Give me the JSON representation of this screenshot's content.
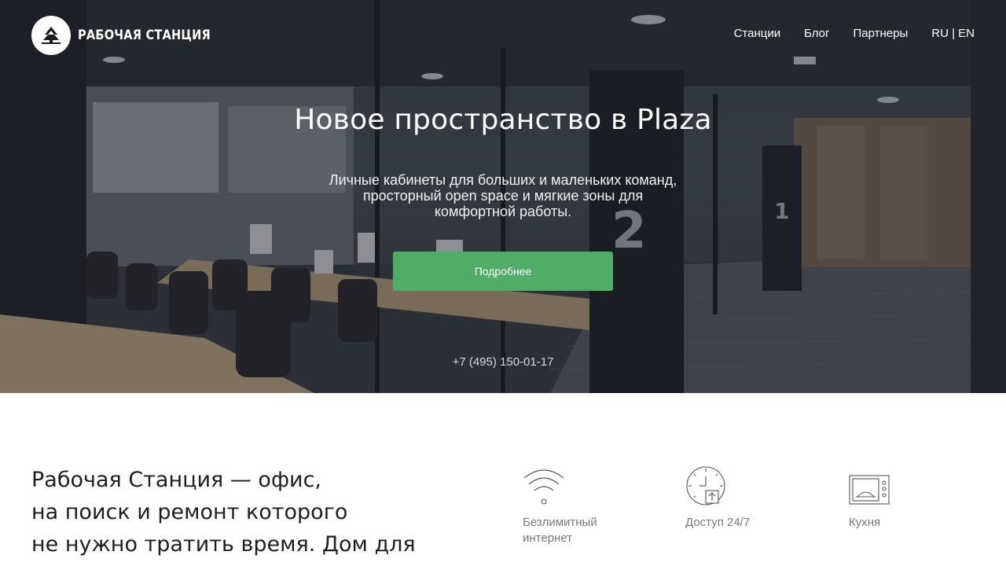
{
  "brand": {
    "name": "РАБОЧАЯ СТАНЦИЯ",
    "logo_icon": "pine-trees-logo-icon"
  },
  "nav": {
    "items": [
      {
        "label": "Станции"
      },
      {
        "label": "Блог"
      },
      {
        "label": "Партнеры"
      }
    ],
    "language": "RU | EN"
  },
  "hero": {
    "title": "Новое пространство в Plaza",
    "subtitle": "Личные кабинеты для больших и маленьких команд, просторный open space и мягкие зоны для комфортной работы.",
    "cta_label": "Подробнее",
    "phone": "+7 (495) 150-01-17",
    "room_numbers": [
      "2",
      "1"
    ]
  },
  "about": {
    "lines": [
      "Рабочая Станция — офис,",
      "на поиск и ремонт которого",
      "не нужно тратить время. Дом для"
    ]
  },
  "features": [
    {
      "icon": "wifi-icon",
      "label_line1": "Безлимитный",
      "label_line2": "интернет"
    },
    {
      "icon": "clock-24-7-icon",
      "label_line1": "Доступ 24/7",
      "label_line2": ""
    },
    {
      "icon": "microwave-icon",
      "label_line1": "Кухня",
      "label_line2": ""
    }
  ],
  "colors": {
    "accent_green": "#4fad67",
    "text_dark": "#1e1e1e",
    "text_muted": "#7a7a7a"
  }
}
